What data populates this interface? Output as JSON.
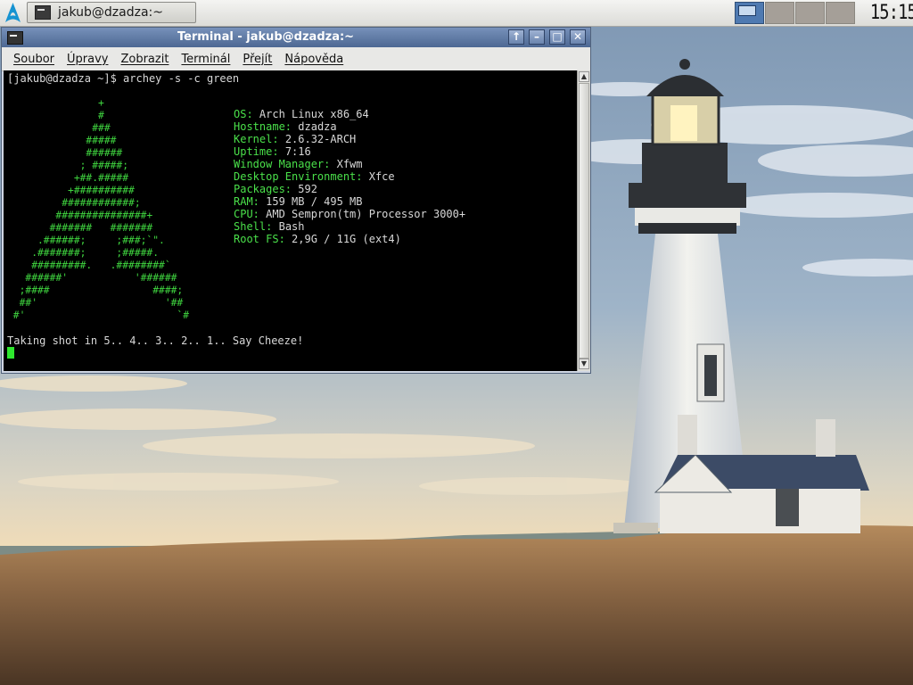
{
  "panel": {
    "task_title": "jakub@dzadza:~",
    "clock": "15:15",
    "workspaces": [
      {
        "active": true
      },
      {
        "active": false
      },
      {
        "active": false
      },
      {
        "active": false
      }
    ]
  },
  "window": {
    "title": "Terminal - jakub@dzadza:~",
    "menu": [
      "Soubor",
      "Úpravy",
      "Zobrazit",
      "Terminál",
      "Přejít",
      "Nápověda"
    ]
  },
  "terminal": {
    "prompt_line": "[jakub@dzadza ~]$ archey -s -c green",
    "ascii_logo": "               +\n               #\n              ###\n             #####\n             ######\n            ; #####;\n           +##.#####\n          +##########\n         ############;\n        ###############+\n       #######   #######\n     .######;     ;###;`\".\n    .#######;     ;#####.\n    #########.   .########`\n   ######'           '######\n  ;####                 ####;\n  ##'                     '##\n #'                         `#",
    "info": [
      {
        "key": "OS:",
        "value": "Arch Linux x86_64"
      },
      {
        "key": "Hostname:",
        "value": "dzadza"
      },
      {
        "key": "Kernel:",
        "value": "2.6.32-ARCH"
      },
      {
        "key": "Uptime:",
        "value": "7:16"
      },
      {
        "key": "Window Manager:",
        "value": "Xfwm"
      },
      {
        "key": "Desktop Environment:",
        "value": "Xfce"
      },
      {
        "key": "Packages:",
        "value": "592"
      },
      {
        "key": "RAM:",
        "value": "159 MB / 495 MB"
      },
      {
        "key": "CPU:",
        "value": "AMD Sempron(tm) Processor 3000+"
      },
      {
        "key": "Shell:",
        "value": "Bash"
      },
      {
        "key": "Root FS:",
        "value": "2,9G / 11G (ext4)"
      }
    ],
    "shot_line": "Taking shot in 5.. 4.. 3.. 2.. 1.. Say Cheeze!"
  },
  "colors": {
    "terminal_green": "#4ae04a",
    "titlebar": "#5a76a3",
    "workspace_active": "#4f7ab1"
  },
  "icons": {
    "launcher": "arch-linux-logo-icon",
    "terminal": "terminal-icon",
    "scroll_up": "arrow-up-icon",
    "minimize": "minimize-icon",
    "maximize": "maximize-icon",
    "close": "close-icon"
  }
}
